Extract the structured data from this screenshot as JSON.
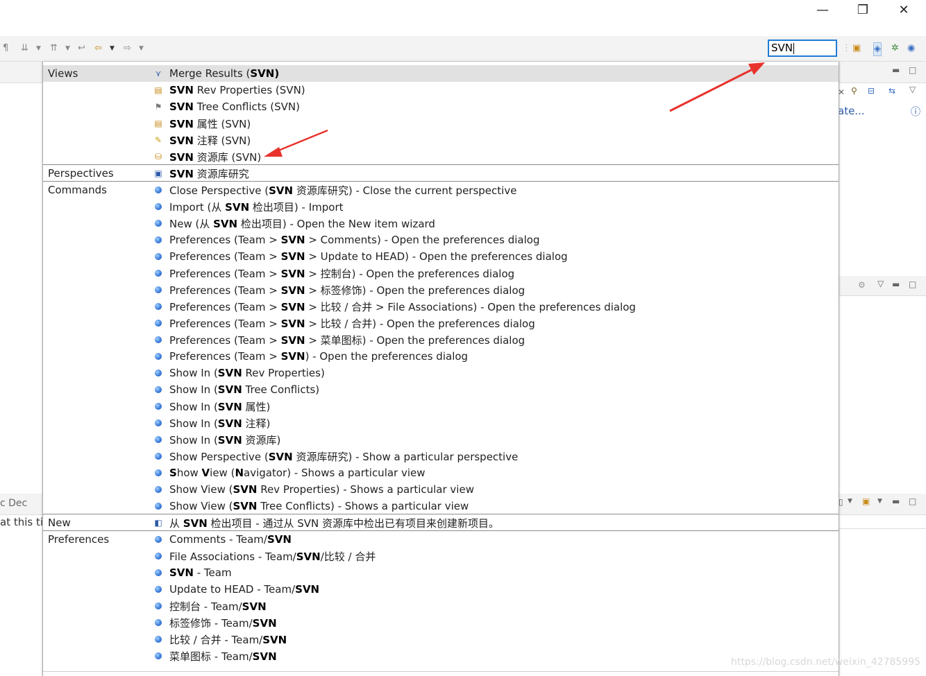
{
  "window": {
    "minimize_glyph": "—",
    "restore_glyph": "❐",
    "close_glyph": "✕"
  },
  "search": {
    "value": "SVN"
  },
  "background": {
    "ate_text": "ate...",
    "dec_tab": "c  Dec",
    "status_text": "at this ti"
  },
  "watermark": "https://blog.csdn.net/weixin_42785995",
  "colors": {
    "accent": "#1e7bd6",
    "arrow": "#e8322c",
    "selected_row": "#e1e1e1"
  },
  "popup": {
    "categories": {
      "views": "Views",
      "perspectives": "Perspectives",
      "commands": "Commands",
      "new": "New",
      "preferences": "Preferences"
    },
    "views": [
      {
        "icon": "merge-results-icon",
        "pre": "Merge Results (",
        "b": "SVN",
        "post": ")",
        "boldclose": true
      },
      {
        "icon": "rev-properties-icon",
        "pre": "",
        "b": "SVN",
        "post": " Rev Properties (SVN)"
      },
      {
        "icon": "tree-conflicts-icon",
        "pre": "",
        "b": "SVN",
        "post": " Tree Conflicts (SVN)"
      },
      {
        "icon": "properties-icon",
        "pre": "",
        "b": "SVN",
        "post": " 属性 (SVN)"
      },
      {
        "icon": "annotate-icon",
        "pre": "",
        "b": "SVN",
        "post": " 注释 (SVN)"
      },
      {
        "icon": "repository-icon",
        "pre": "",
        "b": "SVN",
        "post": " 资源库 (SVN)"
      }
    ],
    "perspectives": [
      {
        "icon": "svn-perspective-icon",
        "pre": "",
        "b": "SVN",
        "post": " 资源库研究"
      }
    ],
    "commands": [
      {
        "pre": "Close Perspective (",
        "b": "SVN",
        "post": " 资源库研究) - Close the current perspective"
      },
      {
        "pre": "Import (从 ",
        "b": "SVN",
        "post": " 检出项目) - Import"
      },
      {
        "pre": "New (从 ",
        "b": "SVN",
        "post": " 检出项目) - Open the New item wizard"
      },
      {
        "pre": "Preferences (Team > ",
        "b": "SVN",
        "post": " > Comments) - Open the preferences dialog"
      },
      {
        "pre": "Preferences (Team > ",
        "b": "SVN",
        "post": " > Update to HEAD) - Open the preferences dialog"
      },
      {
        "pre": "Preferences (Team > ",
        "b": "SVN",
        "post": " > 控制台) - Open the preferences dialog"
      },
      {
        "pre": "Preferences (Team > ",
        "b": "SVN",
        "post": " > 标签修饰) - Open the preferences dialog"
      },
      {
        "pre": "Preferences (Team > ",
        "b": "SVN",
        "post": " > 比较 / 合并 > File Associations) - Open the preferences dialog"
      },
      {
        "pre": "Preferences (Team > ",
        "b": "SVN",
        "post": " > 比较 / 合并) - Open the preferences dialog"
      },
      {
        "pre": "Preferences (Team > ",
        "b": "SVN",
        "post": " > 菜单图标) - Open the preferences dialog"
      },
      {
        "pre": "Preferences (Team > ",
        "b": "SVN",
        "post": ") - Open the preferences dialog"
      },
      {
        "pre": "Show In (",
        "b": "SVN",
        "post": " Rev Properties)"
      },
      {
        "pre": "Show In (",
        "b": "SVN",
        "post": " Tree Conflicts)"
      },
      {
        "pre": "Show In (",
        "b": "SVN",
        "post": " 属性)"
      },
      {
        "pre": "Show In (",
        "b": "SVN",
        "post": " 注释)"
      },
      {
        "pre": "Show In (",
        "b": "SVN",
        "post": " 资源库)"
      },
      {
        "pre": "Show Perspective (",
        "b": "SVN",
        "post": " 资源库研究) - Show a particular perspective"
      },
      {
        "pre": "",
        "b": "S",
        "post": "how ",
        "b2": "V",
        "post2": "iew (",
        "b3": "N",
        "post3": "avigator) - Shows a particular view"
      },
      {
        "pre": "Show View (",
        "b": "SVN",
        "post": " Rev Properties) - Shows a particular view"
      },
      {
        "pre": "Show View (",
        "b": "SVN",
        "post": " Tree Conflicts) - Shows a particular view"
      }
    ],
    "new": [
      {
        "icon": "checkout-wizard-icon",
        "pre": "从 ",
        "b": "SVN",
        "post": " 检出项目 - 通过从 SVN 资源库中检出已有项目来创建新项目。"
      }
    ],
    "preferences": [
      {
        "pre": "Comments - Team/",
        "b": "SVN",
        "post": ""
      },
      {
        "pre": "File Associations - Team/",
        "b": "SVN",
        "post": "/比较 / 合并"
      },
      {
        "pre": "",
        "b": "SVN",
        "post": " - Team"
      },
      {
        "pre": "Update to HEAD - Team/",
        "b": "SVN",
        "post": ""
      },
      {
        "pre": "控制台 - Team/",
        "b": "SVN",
        "post": ""
      },
      {
        "pre": "标签修饰 - Team/",
        "b": "SVN",
        "post": ""
      },
      {
        "pre": "比较 / 合并 - Team/",
        "b": "SVN",
        "post": ""
      },
      {
        "pre": "菜单图标 - Team/",
        "b": "SVN",
        "post": ""
      }
    ]
  }
}
